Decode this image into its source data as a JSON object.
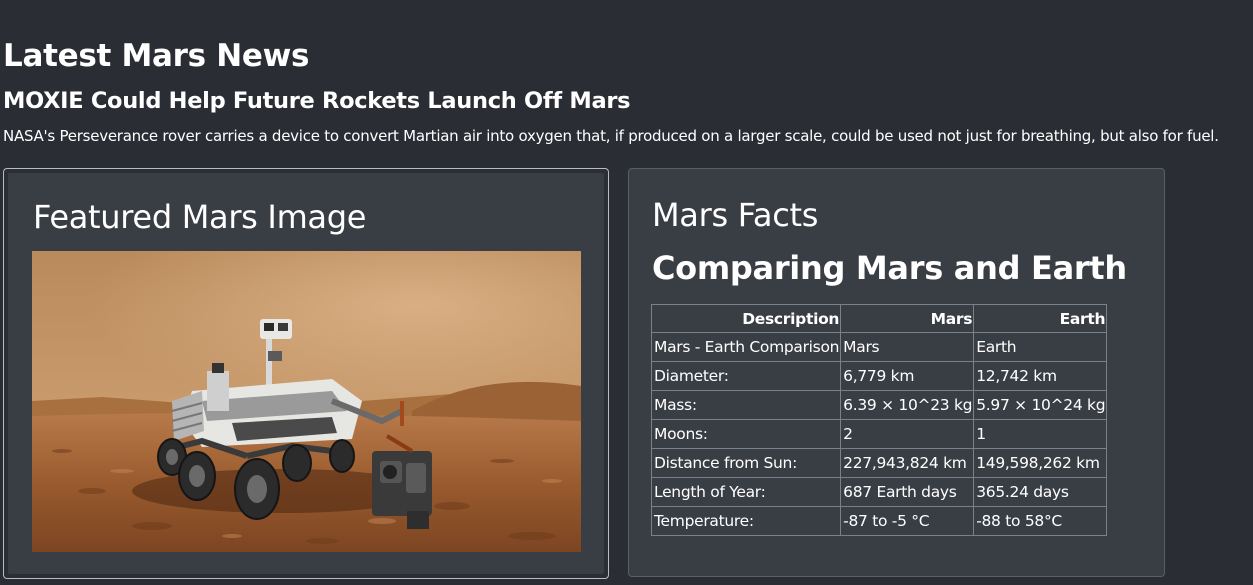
{
  "news": {
    "heading": "Latest Mars News",
    "title": "MOXIE Could Help Future Rockets Launch Off Mars",
    "teaser": "NASA's Perseverance rover carries a device to convert Martian air into oxygen that, if produced on a larger scale, could be used not just for breathing, but also for fuel."
  },
  "featured_image": {
    "title": "Featured Mars Image",
    "image": "mars-rover-photo"
  },
  "facts": {
    "title": "Mars Facts",
    "subtitle": "Comparing Mars and Earth",
    "columns": [
      "Description",
      "Mars",
      "Earth"
    ],
    "rows": [
      [
        "Mars - Earth Comparison",
        "Mars",
        "Earth"
      ],
      [
        "Diameter:",
        "6,779 km",
        "12,742 km"
      ],
      [
        "Mass:",
        "6.39 × 10^23 kg",
        "5.97 × 10^24 kg"
      ],
      [
        "Moons:",
        "2",
        "1"
      ],
      [
        "Distance from Sun:",
        "227,943,824 km",
        "149,598,262 km"
      ],
      [
        "Length of Year:",
        "687 Earth days",
        "365.24 days"
      ],
      [
        "Temperature:",
        "-87 to -5 °C",
        "-88 to 58°C"
      ]
    ]
  },
  "colors": {
    "background": "#2a2d33",
    "card": "#393d44",
    "text": "#ffffff",
    "border": "#7c8088"
  }
}
